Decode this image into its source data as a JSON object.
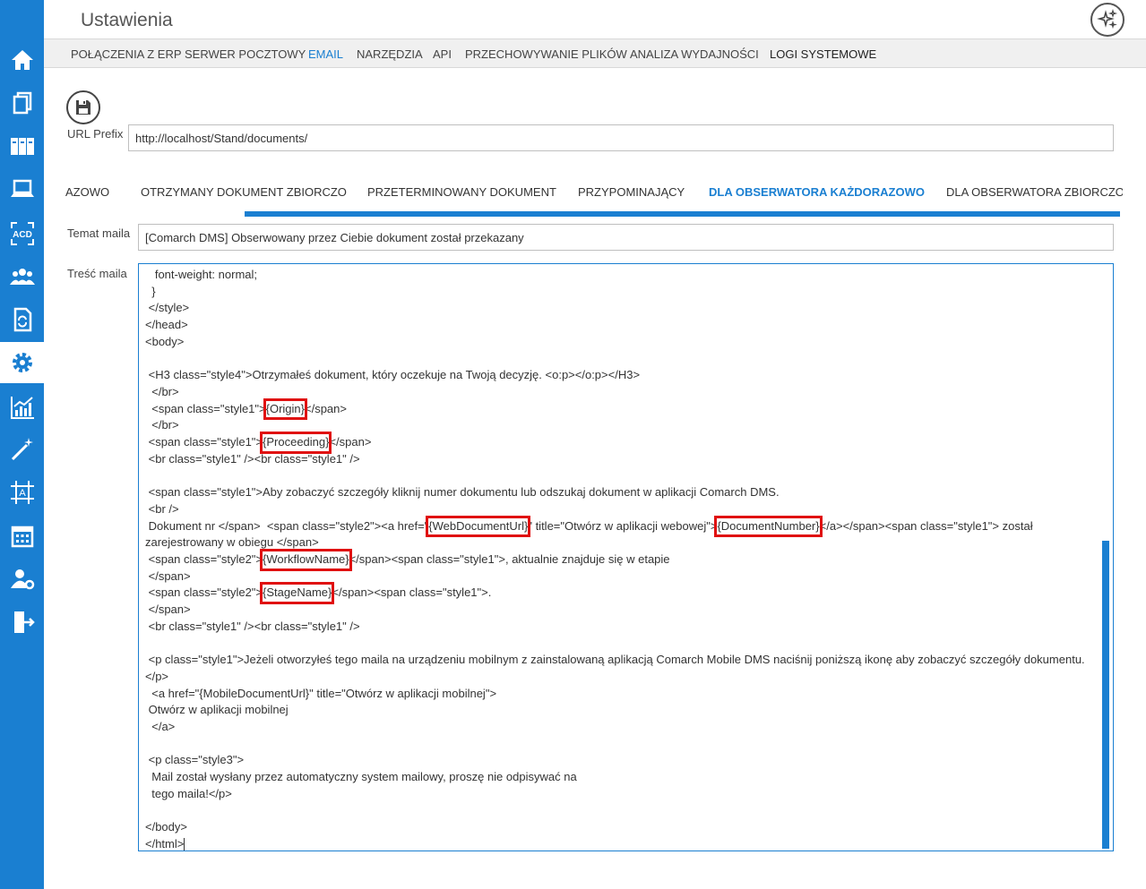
{
  "app": {
    "title": "Ustawienia"
  },
  "sidebar": {
    "items": [
      {
        "icon": "home-icon"
      },
      {
        "icon": "documents-icon"
      },
      {
        "icon": "binders-icon"
      },
      {
        "icon": "laptop-icon"
      },
      {
        "icon": "ocr-acd-icon",
        "label": "ACD"
      },
      {
        "icon": "users-icon"
      },
      {
        "icon": "document-sync-icon"
      },
      {
        "icon": "gear-icon",
        "active": true
      },
      {
        "icon": "chart-icon"
      },
      {
        "icon": "magic-wand-icon"
      },
      {
        "icon": "text-frame-icon",
        "label": "A"
      },
      {
        "icon": "calendar-icon"
      },
      {
        "icon": "user-settings-icon"
      },
      {
        "icon": "logout-icon"
      }
    ]
  },
  "topnav": {
    "items": [
      "POŁĄCZENIA Z ERP",
      "SERWER POCZTOWY",
      "EMAIL",
      "NARZĘDZIA",
      "API",
      "PRZECHOWYWANIE PLIKÓW",
      "ANALIZA WYDAJNOŚCI",
      "LOGI SYSTEMOWE"
    ],
    "active": "EMAIL"
  },
  "url_prefix": {
    "label": "URL Prefix",
    "value": "http://localhost/Stand/documents/"
  },
  "subtabs": {
    "items": [
      "AZOWO",
      "OTRZYMANY DOKUMENT ZBIORCZO",
      "PRZETERMINOWANY DOKUMENT",
      "PRZYPOMINAJĄCY",
      "DLA OBSERWATORA KAŻDORAZOWO",
      "DLA OBSERWATORA ZBIORCZO"
    ],
    "active": "DLA OBSERWATORA KAŻDORAZOWO"
  },
  "subject": {
    "label": "Temat maila",
    "value": "[Comarch DMS] Obserwowany przez Ciebie dokument został przekazany"
  },
  "mail_body": {
    "label": "Treść maila",
    "lines": [
      "   font-weight: normal;",
      "  }",
      " </style>",
      "</head>",
      "<body>",
      "",
      " <H3 class=\"style4\">Otrzymałeś dokument, który oczekuje na Twoją decyzję. <o:p></o:p></H3>",
      "  </br>",
      "  <span class=\"style1\">{Origin}</span>",
      "  </br>",
      " <span class=\"style1\">{Proceeding}</span>",
      " <br class=\"style1\" /><br class=\"style1\" />",
      "",
      " <span class=\"style1\">Aby zobaczyć szczegóły kliknij numer dokumentu lub odszukaj dokument w aplikacji Comarch DMS.",
      " <br />",
      " Dokument nr </span>  <span class=\"style2\"><a href=\"{WebDocumentUrl}\" title=\"Otwórz w aplikacji webowej\">{DocumentNumber}</a></span><span class=\"style1\"> został zarejestrowany w obiegu </span>",
      " <span class=\"style2\">{WorkflowName}</span><span class=\"style1\">, aktualnie znajduje się w etapie",
      " </span>",
      " <span class=\"style2\">{StageName}</span><span class=\"style1\">.",
      " </span>",
      " <br class=\"style1\" /><br class=\"style1\" />",
      "",
      " <p class=\"style1\">Jeżeli otworzyłeś tego maila na urządzeniu mobilnym z zainstalowaną aplikacją Comarch Mobile DMS naciśnij poniższą ikonę aby zobaczyć szczegóły dokumentu.</p>",
      "  <a href=\"{MobileDocumentUrl}\" title=\"Otwórz w aplikacji mobilnej\">",
      " Otwórz w aplikacji mobilnej",
      "  </a>",
      "",
      " <p class=\"style3\">",
      "  Mail został wysłany przez automatyczny system mailowy, proszę nie odpisywać na",
      "  tego maila!</p>",
      "",
      "</body>",
      "</html>"
    ],
    "highlighted_tokens": [
      "{Origin}",
      "{Proceeding}",
      "{WebDocumentUrl}",
      "{DocumentNumber}",
      "{WorkflowName}",
      "{StageName}"
    ]
  },
  "colors": {
    "accent": "#1a7fd1",
    "highlight_box": "#e01010"
  }
}
